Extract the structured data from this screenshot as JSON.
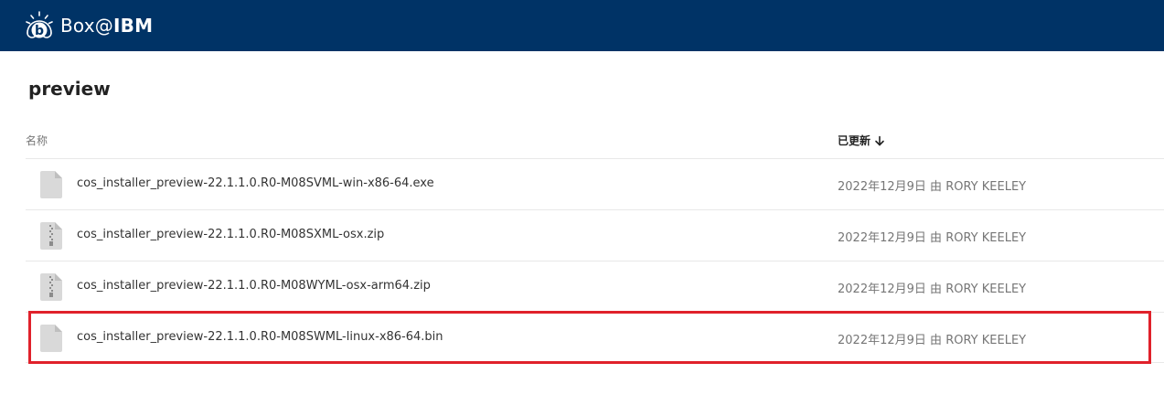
{
  "header": {
    "logo_icon": "box-logo-icon",
    "brand_prefix": "Box@",
    "brand_suffix": "IBM",
    "background_color": "#003366"
  },
  "folder": {
    "title": "preview"
  },
  "columns": {
    "name": "名称",
    "updated": "已更新",
    "sort_icon": "arrow-down-icon"
  },
  "files": [
    {
      "name": "cos_installer_preview-22.1.1.0.R0-M08SVML-win-x86-64.exe",
      "icon": "file-icon",
      "date": "2022年12月9日",
      "by": "由",
      "user": "RORY KEELEY"
    },
    {
      "name": "cos_installer_preview-22.1.1.0.R0-M08SXML-osx.zip",
      "icon": "zip-file-icon",
      "date": "2022年12月9日",
      "by": "由",
      "user": "RORY KEELEY"
    },
    {
      "name": "cos_installer_preview-22.1.1.0.R0-M08WYML-osx-arm64.zip",
      "icon": "zip-file-icon",
      "date": "2022年12月9日",
      "by": "由",
      "user": "RORY KEELEY"
    },
    {
      "name": "cos_installer_preview-22.1.1.0.R0-M08SWML-linux-x86-64.bin",
      "icon": "file-icon",
      "date": "2022年12月9日",
      "by": "由",
      "user": "RORY KEELEY"
    }
  ],
  "highlight_color": "#e0212b"
}
